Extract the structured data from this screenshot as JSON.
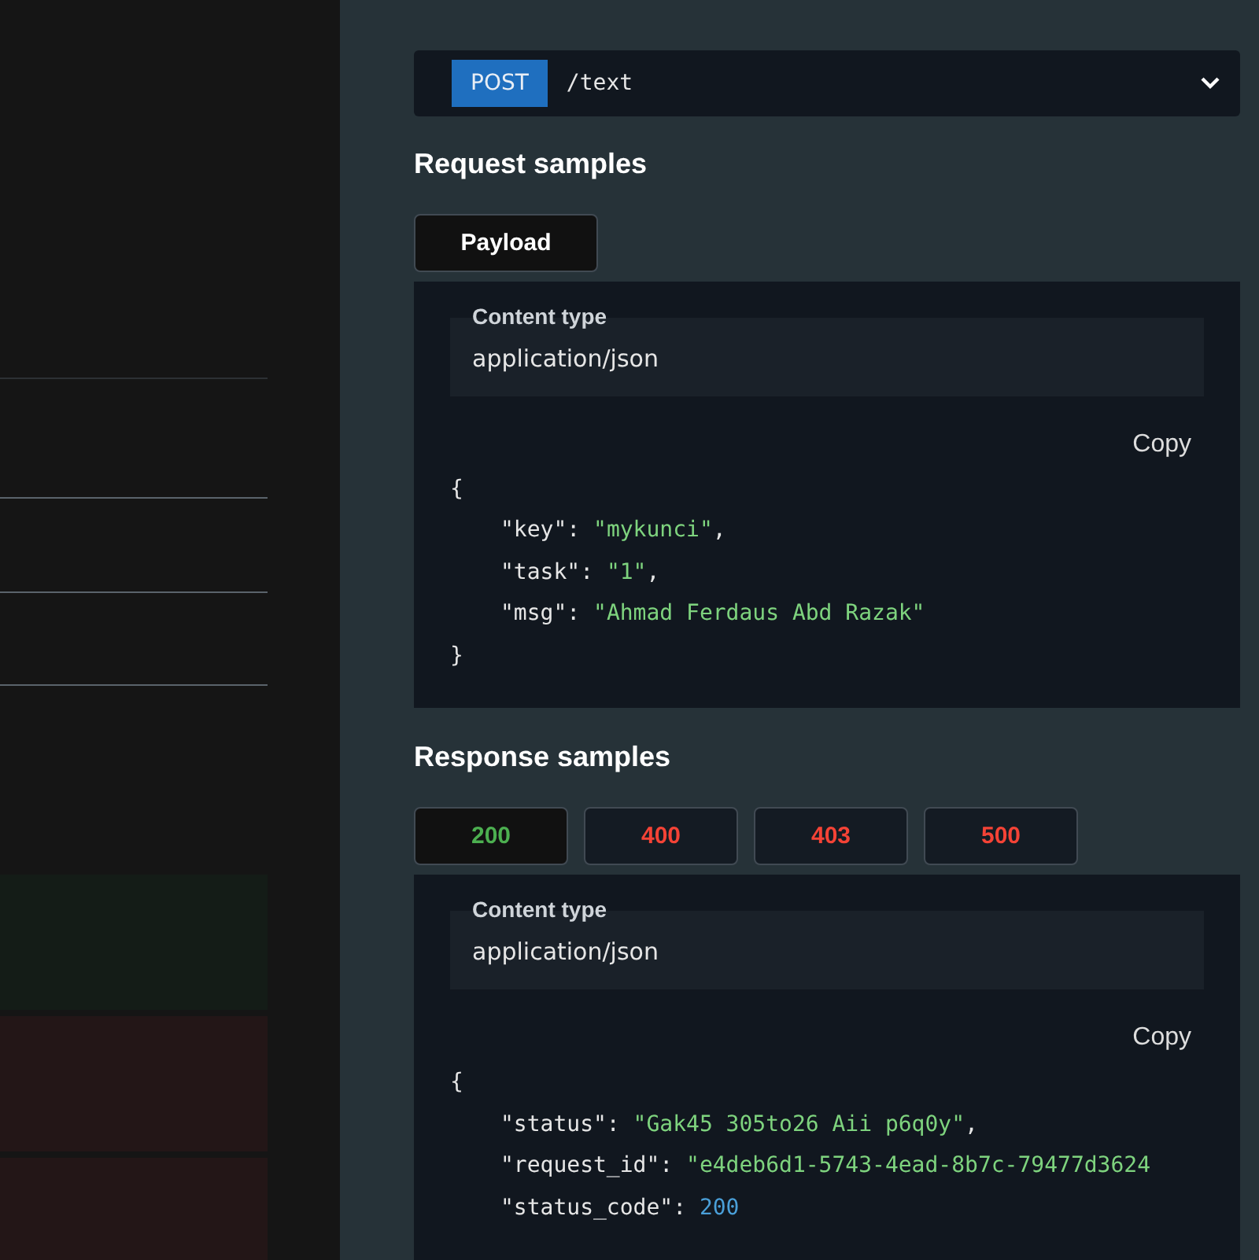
{
  "endpoint": {
    "method": "POST",
    "path": "/text"
  },
  "request_samples": {
    "title": "Request samples",
    "tabs": [
      {
        "label": "Payload",
        "selected": true
      }
    ],
    "content_type": {
      "label": "Content type",
      "value": "application/json"
    },
    "copy": "Copy",
    "code": [
      {
        "kind": "brace",
        "text": "{"
      },
      {
        "kind": "string",
        "key": "\"key\":",
        "value": "\"mykunci\"",
        "tail": ","
      },
      {
        "kind": "string",
        "key": "\"task\":",
        "value": "\"1\"",
        "tail": ","
      },
      {
        "kind": "string",
        "key": "\"msg\":",
        "value": "\"Ahmad Ferdaus Abd Razak\""
      },
      {
        "kind": "brace",
        "text": "}"
      }
    ]
  },
  "response_samples": {
    "title": "Response samples",
    "tabs": [
      {
        "label": "200",
        "selected": true,
        "kind": "success"
      },
      {
        "label": "400",
        "selected": false,
        "kind": "error"
      },
      {
        "label": "403",
        "selected": false,
        "kind": "error"
      },
      {
        "label": "500",
        "selected": false,
        "kind": "error"
      }
    ],
    "content_type": {
      "label": "Content type",
      "value": "application/json"
    },
    "copy": "Copy",
    "code": [
      {
        "kind": "brace",
        "text": "{"
      },
      {
        "kind": "string",
        "key": "\"status\":",
        "value": "\"Gak45 305to26 Aii p6q0y\"",
        "tail": ","
      },
      {
        "kind": "string",
        "key": "\"request_id\":",
        "value": "\"e4deb6d1-5743-4ead-8b7c-79477d3624"
      },
      {
        "kind": "number",
        "key": "\"status_code\":",
        "value": "200"
      }
    ]
  }
}
